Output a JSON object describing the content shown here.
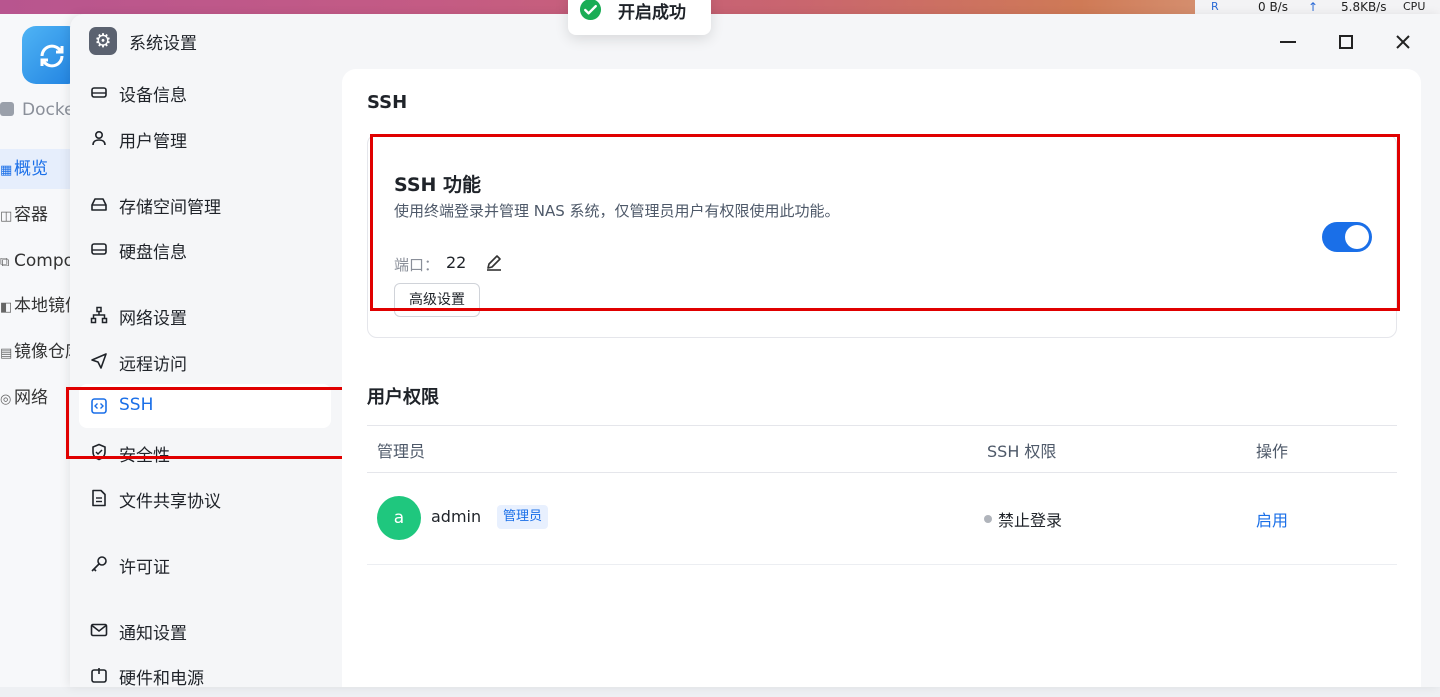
{
  "status_bar": {
    "r_label": "R",
    "r_value": "0 B/s",
    "up_arrow": "↑",
    "up_value": "5.8KB/s",
    "cpu_label": "CPU"
  },
  "background_app": {
    "docker_label": "Docke",
    "menu": [
      {
        "label": "概览",
        "icon": "grid-icon",
        "active": true
      },
      {
        "label": "容器",
        "icon": "container-icon",
        "active": false
      },
      {
        "label": "Compo",
        "icon": "compose-icon",
        "active": false
      },
      {
        "label": "本地镜像",
        "icon": "image-icon",
        "active": false
      },
      {
        "label": "镜像仓库",
        "icon": "repo-icon",
        "active": false
      },
      {
        "label": "网络",
        "icon": "network-icon",
        "active": false
      }
    ]
  },
  "window": {
    "title": "系统设置",
    "controls": [
      "minimize",
      "maximize",
      "close"
    ]
  },
  "sidebar": {
    "items": [
      {
        "label": "设备信息",
        "icon": "device-icon"
      },
      {
        "label": "用户管理",
        "icon": "user-icon"
      },
      {
        "label": "存储空间管理",
        "icon": "storage-icon"
      },
      {
        "label": "硬盘信息",
        "icon": "disk-icon"
      },
      {
        "label": "网络设置",
        "icon": "network-icon"
      },
      {
        "label": "远程访问",
        "icon": "send-icon"
      },
      {
        "label": "SSH",
        "icon": "ssh-icon",
        "active": true
      },
      {
        "label": "安全性",
        "icon": "shield-icon"
      },
      {
        "label": "文件共享协议",
        "icon": "file-icon"
      },
      {
        "label": "许可证",
        "icon": "key-icon"
      },
      {
        "label": "通知设置",
        "icon": "mail-icon"
      },
      {
        "label": "硬件和电源",
        "icon": "power-icon"
      }
    ]
  },
  "ssh": {
    "section_title": "SSH",
    "card_title": "SSH 功能",
    "description": "使用终端登录并管理 NAS 系统，仅管理员用户有权限使用此功能。",
    "port_label": "端口：",
    "port_value": "22",
    "advanced_button": "高级设置",
    "enabled": true
  },
  "permissions": {
    "section_title": "用户权限",
    "columns": [
      "管理员",
      "SSH 权限",
      "操作"
    ],
    "rows": [
      {
        "avatar": "a",
        "name": "admin",
        "role": "管理员",
        "status": "禁止登录",
        "action": "启用"
      }
    ]
  },
  "toast": {
    "message": "开启成功"
  },
  "colors": {
    "accent": "#1a6fe8",
    "avatar_green": "#1fc77e",
    "annotation_red": "#e00000",
    "toast_check": "#1aad55"
  }
}
